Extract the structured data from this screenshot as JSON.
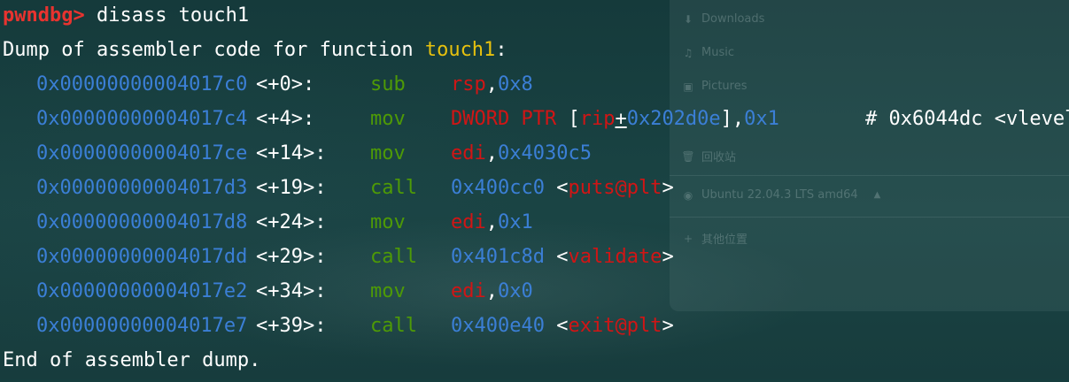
{
  "sidebar": {
    "items": [
      {
        "icon": "download-icon",
        "glyph": "⬇",
        "label": "Downloads"
      },
      {
        "icon": "music-icon",
        "glyph": "♫",
        "label": "Music"
      },
      {
        "icon": "pictures-icon",
        "glyph": "▣",
        "label": "Pictures"
      },
      {
        "icon": "trash-icon",
        "glyph": "🗑",
        "label": "回收站"
      },
      {
        "icon": "disk-icon",
        "glyph": "◉",
        "label": "Ubuntu 22.04.3 LTS amd64",
        "eject": "▲"
      },
      {
        "icon": "plus-icon",
        "glyph": "+",
        "label": "其他位置"
      }
    ]
  },
  "terminal": {
    "prompt": "pwndbg>",
    "command": " disass touch1",
    "header_prefix": "Dump of assembler code for function ",
    "header_function": "touch1",
    "header_suffix": ":",
    "footer": "End of assembler dump.",
    "rows": [
      {
        "address": "0x00000000004017c0",
        "offset": "<+0>:",
        "mnemonic": "sub",
        "operands": [
          {
            "text": "rsp",
            "kind": "reg"
          },
          {
            "text": ",",
            "kind": "w"
          },
          {
            "text": "0x8",
            "kind": "addr"
          }
        ],
        "comment": ""
      },
      {
        "address": "0x00000000004017c4",
        "offset": "<+4>:",
        "mnemonic": "mov",
        "operands": [
          {
            "text": "DWORD PTR ",
            "kind": "reg"
          },
          {
            "text": "[",
            "kind": "w"
          },
          {
            "text": "rip",
            "kind": "reg"
          },
          {
            "text": "+",
            "kind": "w",
            "underline": true
          },
          {
            "text": "0x202d0e",
            "kind": "addr"
          },
          {
            "text": "],",
            "kind": "w"
          },
          {
            "text": "0x1",
            "kind": "addr"
          }
        ],
        "comment": "# 0x6044dc <vlevel"
      },
      {
        "address": "0x00000000004017ce",
        "offset": "<+14>:",
        "mnemonic": "mov",
        "operands": [
          {
            "text": "edi",
            "kind": "reg"
          },
          {
            "text": ",",
            "kind": "w"
          },
          {
            "text": "0x4030c5",
            "kind": "addr"
          }
        ],
        "comment": ""
      },
      {
        "address": "0x00000000004017d3",
        "offset": "<+19>:",
        "mnemonic": "call",
        "operands": [
          {
            "text": "0x400cc0",
            "kind": "addr"
          },
          {
            "text": " <",
            "kind": "w"
          },
          {
            "text": "puts@plt",
            "kind": "reg"
          },
          {
            "text": ">",
            "kind": "w"
          }
        ],
        "comment": ""
      },
      {
        "address": "0x00000000004017d8",
        "offset": "<+24>:",
        "mnemonic": "mov",
        "operands": [
          {
            "text": "edi",
            "kind": "reg"
          },
          {
            "text": ",",
            "kind": "w"
          },
          {
            "text": "0x1",
            "kind": "addr"
          }
        ],
        "comment": ""
      },
      {
        "address": "0x00000000004017dd",
        "offset": "<+29>:",
        "mnemonic": "call",
        "operands": [
          {
            "text": "0x401c8d",
            "kind": "addr"
          },
          {
            "text": " <",
            "kind": "w"
          },
          {
            "text": "validate",
            "kind": "reg"
          },
          {
            "text": ">",
            "kind": "w"
          }
        ],
        "comment": ""
      },
      {
        "address": "0x00000000004017e2",
        "offset": "<+34>:",
        "mnemonic": "mov",
        "operands": [
          {
            "text": "edi",
            "kind": "reg"
          },
          {
            "text": ",",
            "kind": "w"
          },
          {
            "text": "0x0",
            "kind": "addr"
          }
        ],
        "comment": ""
      },
      {
        "address": "0x00000000004017e7",
        "offset": "<+39>:",
        "mnemonic": "call",
        "operands": [
          {
            "text": "0x400e40",
            "kind": "addr"
          },
          {
            "text": " <",
            "kind": "w"
          },
          {
            "text": "exit@plt",
            "kind": "reg"
          },
          {
            "text": ">",
            "kind": "w"
          }
        ],
        "comment": ""
      }
    ]
  }
}
